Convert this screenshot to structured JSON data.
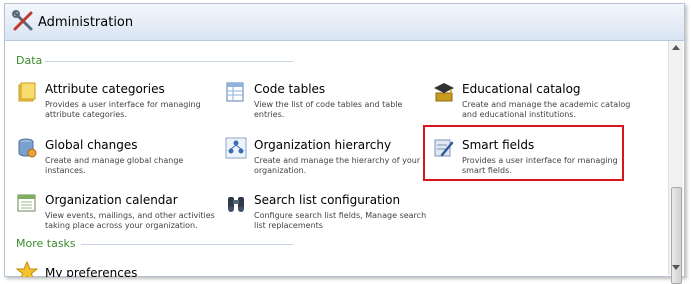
{
  "window": {
    "title": "Administration"
  },
  "sections": {
    "data": "Data",
    "more_tasks": "More tasks"
  },
  "tasks": [
    {
      "name": "Attribute categories",
      "desc": "Provides a user interface for managing attribute categories.",
      "icon": "folder-icon"
    },
    {
      "name": "Code tables",
      "desc": "View the list of code tables and table entries.",
      "icon": "table-icon"
    },
    {
      "name": "Educational catalog",
      "desc": "Create and manage the academic catalog and educational institutions.",
      "icon": "graduation-cap-icon"
    },
    {
      "name": "Global changes",
      "desc": "Create and manage global change instances.",
      "icon": "database-icon"
    },
    {
      "name": "Organization hierarchy",
      "desc": "Create and manage the hierarchy of your organization.",
      "icon": "hierarchy-icon"
    },
    {
      "name": "Smart fields",
      "desc": "Provides a user interface for managing smart fields.",
      "icon": "smart-field-icon"
    },
    {
      "name": "Organization calendar",
      "desc": "View events, mailings, and other activities taking place across your organization.",
      "icon": "calendar-icon"
    },
    {
      "name": "Search list configuration",
      "desc": "Configure search list fields, Manage search list replacements",
      "icon": "binoculars-icon"
    }
  ],
  "more_tasks": [
    {
      "name": "My preferences",
      "icon": "star-icon"
    }
  ]
}
